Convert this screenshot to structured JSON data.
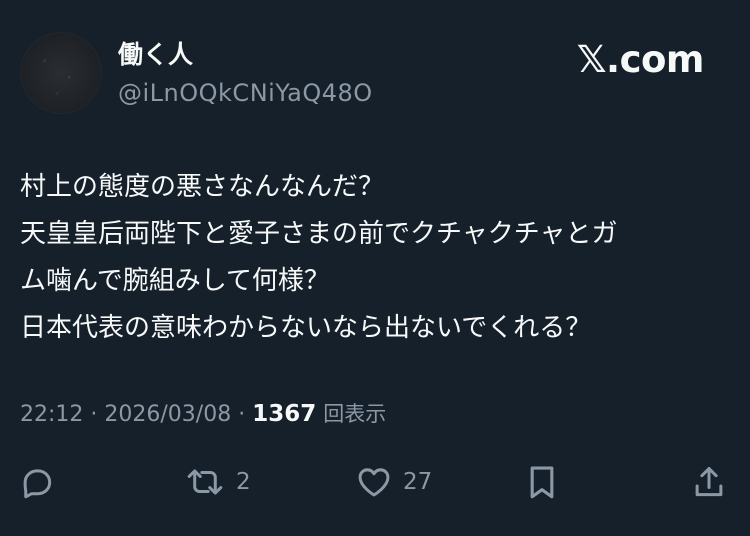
{
  "author": {
    "display_name": "働く人",
    "handle": "@iLnOQkCNiYaQ48O"
  },
  "brand": "𝕏.com",
  "tweet": {
    "lines": [
      "村上の態度の悪さなんなんだ？",
      "天皇皇后両陛下と愛子さまの前でクチャクチャとガ",
      "ム噛んで腕組みして何様？",
      "日本代表の意味わからないなら出ないでくれる？"
    ]
  },
  "meta": {
    "time": "22:12",
    "separator": "·",
    "date": "2026/03/08",
    "views_count": "1367",
    "views_label": "回表示"
  },
  "actions": {
    "reply": {
      "icon": "reply-icon",
      "count": ""
    },
    "retweet": {
      "icon": "retweet-icon",
      "count": "2"
    },
    "like": {
      "icon": "heart-icon",
      "count": "27"
    },
    "bookmark": {
      "icon": "bookmark-icon",
      "count": ""
    },
    "share": {
      "icon": "share-icon",
      "count": ""
    }
  },
  "colors": {
    "background": "#15202b",
    "text_primary": "#f7f9f9",
    "text_secondary": "#8b98a5"
  }
}
